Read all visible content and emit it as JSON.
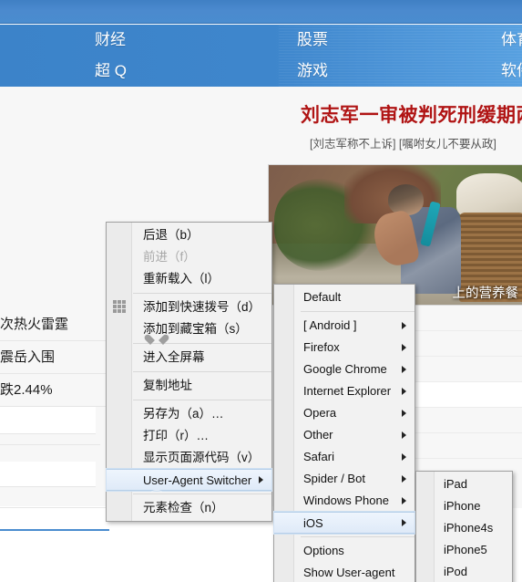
{
  "site": {
    "nav_rows": [
      {
        "items": [
          "财经",
          "股票",
          "体育"
        ]
      },
      {
        "items": [
          "超 Q",
          "游戏",
          "软件"
        ]
      }
    ],
    "headline": "刘志军一审被判死刑缓期两年",
    "subline": "[刘志军称不上诉]  [嘱咐女儿不要从政]",
    "photo_caption": "上的营养餐",
    "left_list": [
      "次热火雷霆",
      "震岳入围",
      "跌2.44%"
    ]
  },
  "context_menu": {
    "title": "browser-context-menu",
    "items": [
      {
        "label": "后退（b）",
        "icon": null,
        "state": "normal",
        "submenu": false
      },
      {
        "label": "前进（f）",
        "icon": null,
        "state": "disabled",
        "submenu": false
      },
      {
        "label": "重新载入（l）",
        "icon": null,
        "state": "normal",
        "submenu": false
      },
      {
        "separator": true
      },
      {
        "label": "添加到快速拨号（d）",
        "icon": "grid-icon",
        "state": "normal",
        "submenu": false
      },
      {
        "label": "添加到藏宝箱（s）",
        "icon": "heart-icon",
        "state": "normal",
        "submenu": false
      },
      {
        "separator": true
      },
      {
        "label": "进入全屏幕",
        "icon": null,
        "state": "normal",
        "submenu": false
      },
      {
        "separator": true
      },
      {
        "label": "复制地址",
        "icon": null,
        "state": "normal",
        "submenu": false
      },
      {
        "separator": true
      },
      {
        "label": "另存为（a）…",
        "icon": null,
        "state": "normal",
        "submenu": false
      },
      {
        "label": "打印（r）…",
        "icon": null,
        "state": "normal",
        "submenu": false
      },
      {
        "label": "显示页面源代码（v）",
        "icon": null,
        "state": "normal",
        "submenu": false
      },
      {
        "label": "User-Agent Switcher",
        "icon": "globe-icon",
        "state": "selected",
        "submenu": true
      },
      {
        "separator": true
      },
      {
        "label": "元素检查（n）",
        "icon": null,
        "state": "normal",
        "submenu": false
      }
    ]
  },
  "ua_submenu": {
    "title": "user-agent-switcher-submenu",
    "items": [
      {
        "label": "Default",
        "state": "normal",
        "submenu": false
      },
      {
        "separator": true
      },
      {
        "label": "[ Android ]",
        "state": "normal",
        "submenu": true
      },
      {
        "label": "Firefox",
        "state": "normal",
        "submenu": true
      },
      {
        "label": "Google Chrome",
        "state": "normal",
        "submenu": true
      },
      {
        "label": "Internet Explorer",
        "state": "normal",
        "submenu": true
      },
      {
        "label": "Opera",
        "state": "normal",
        "submenu": true
      },
      {
        "label": "Other",
        "state": "normal",
        "submenu": true
      },
      {
        "label": "Safari",
        "state": "normal",
        "submenu": true
      },
      {
        "label": "Spider / Bot",
        "state": "normal",
        "submenu": true
      },
      {
        "label": "Windows Phone",
        "state": "normal",
        "submenu": true
      },
      {
        "label": "iOS",
        "state": "selected",
        "submenu": true
      },
      {
        "separator": true
      },
      {
        "label": "Options",
        "state": "normal",
        "submenu": false
      },
      {
        "label": "Show User-agent",
        "state": "normal",
        "submenu": false
      }
    ]
  },
  "ios_submenu": {
    "title": "ios-device-submenu",
    "items": [
      {
        "label": "iPad",
        "state": "normal"
      },
      {
        "label": "iPhone",
        "state": "normal"
      },
      {
        "label": "iPhone4s",
        "state": "normal"
      },
      {
        "label": "iPhone5",
        "state": "normal"
      },
      {
        "label": "iPod",
        "state": "normal"
      }
    ]
  },
  "colors": {
    "nav_blue": "#3e86cc",
    "headline_red": "#b01414",
    "menu_bg": "#f2f2f2",
    "menu_border": "#a0a0a0",
    "selected_bg": "#dfeaf8",
    "disabled_text": "#a8a8a8"
  }
}
